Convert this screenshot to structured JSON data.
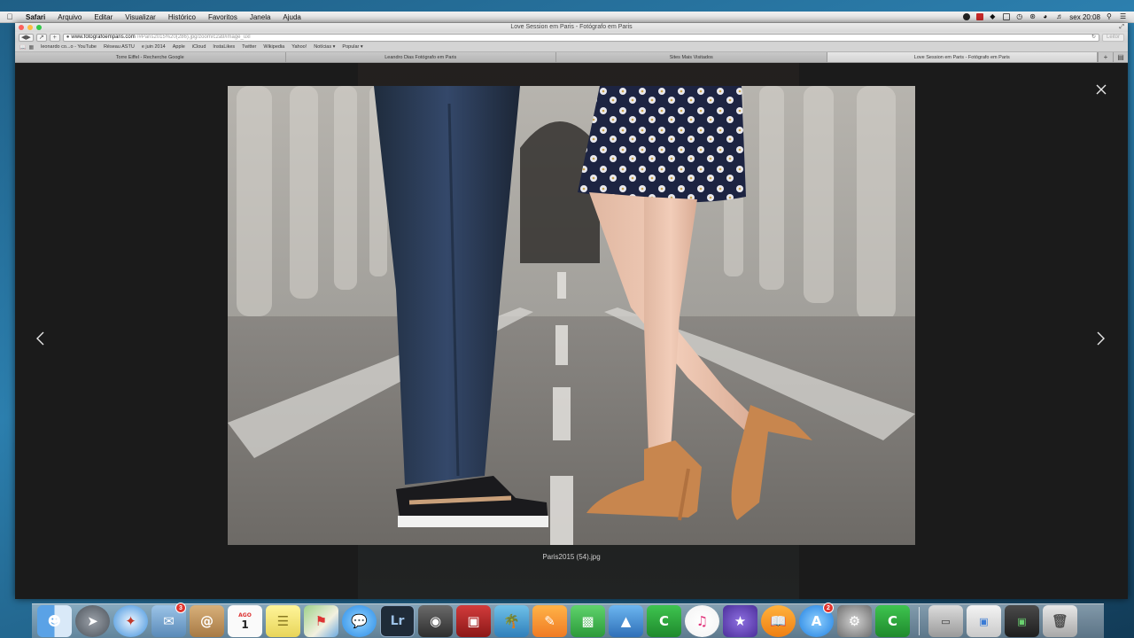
{
  "menubar": {
    "app": "Safari",
    "menus": [
      "Arquivo",
      "Editar",
      "Visualizar",
      "Histórico",
      "Favoritos",
      "Janela",
      "Ajuda"
    ],
    "clock": "sex 20:08"
  },
  "window": {
    "title": "Love Session em Paris - Fotógrafo em Paris",
    "url_host": "www.fotografoemparis.com",
    "url_path": "/#Paris2015%20(286).jpg/zoom/c2a9/image_uxl",
    "reader_label": "Leitor",
    "bookmarks": [
      "leonardo co...o - YouTube",
      "Réseau ASTU",
      "e juin 2014",
      "Apple",
      "iCloud",
      "InstaLikes",
      "Twitter",
      "Wikipedia",
      "Yahoo!",
      "Notícias ▾",
      "Popular ▾"
    ],
    "tabs": [
      {
        "label": "Torre Eiffel - Recherche Google",
        "active": false
      },
      {
        "label": "Leandro Dias Fotógrafo em Paris",
        "active": false
      },
      {
        "label": "Sites Mais Visitados",
        "active": false
      },
      {
        "label": "Love Session em Paris - Fotógrafo em Paris",
        "active": true
      }
    ]
  },
  "lightbox": {
    "caption": "Paris2015 (54).jpg"
  },
  "dock": {
    "badges": {
      "mail": "3",
      "appstore": "2"
    },
    "calendar_month": "AGO",
    "calendar_day": "1",
    "lr_label": "Lr"
  }
}
